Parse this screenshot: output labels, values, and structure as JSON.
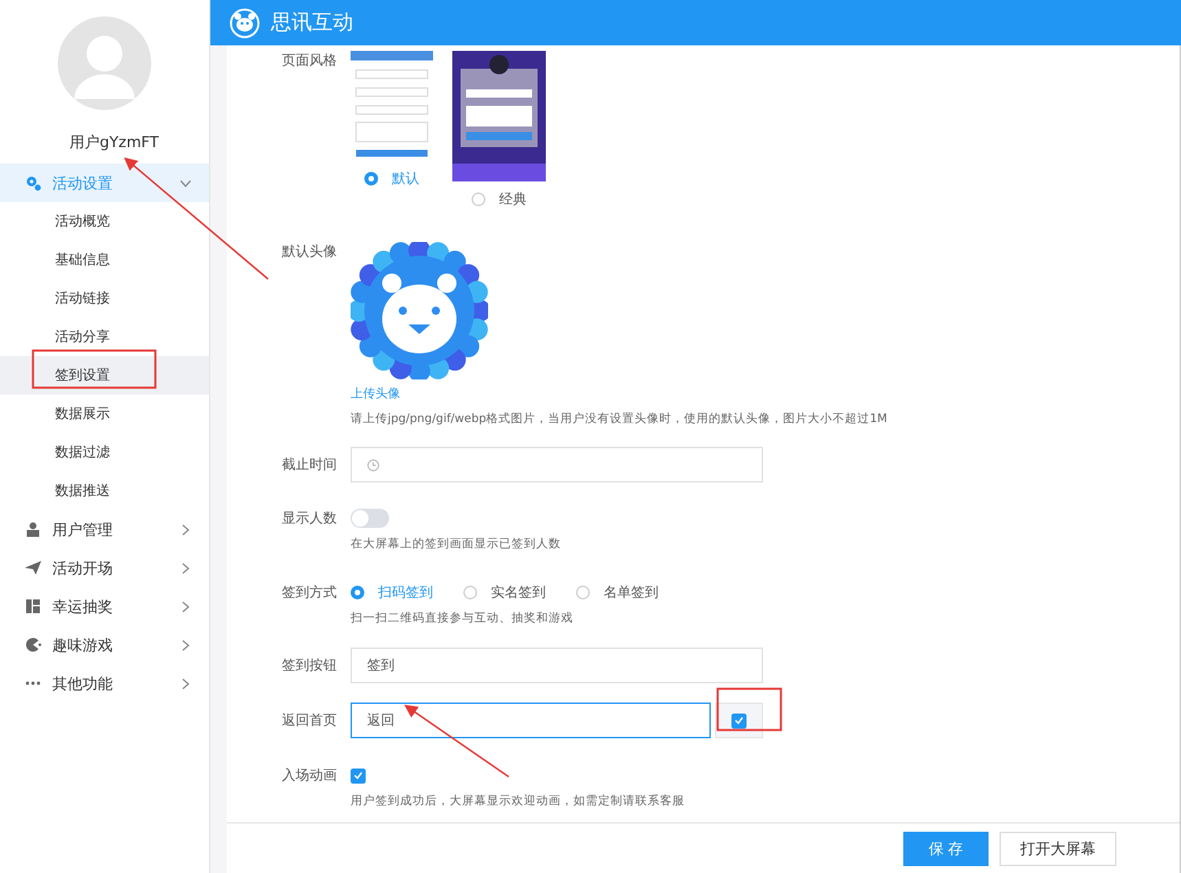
{
  "app": {
    "title": "思讯互动"
  },
  "user": {
    "name": "用户gYzmFT"
  },
  "menu": [
    {
      "label": "活动设置",
      "expanded": true,
      "children": [
        {
          "label": "活动概览",
          "selected": false
        },
        {
          "label": "基础信息",
          "selected": false
        },
        {
          "label": "活动链接",
          "selected": false
        },
        {
          "label": "活动分享",
          "selected": false
        },
        {
          "label": "签到设置",
          "selected": true
        },
        {
          "label": "数据展示",
          "selected": false
        },
        {
          "label": "数据过滤",
          "selected": false
        },
        {
          "label": "数据推送",
          "selected": false
        }
      ]
    },
    {
      "label": "用户管理",
      "expanded": false
    },
    {
      "label": "活动开场",
      "expanded": false
    },
    {
      "label": "幸运抽奖",
      "expanded": false
    },
    {
      "label": "趣味游戏",
      "expanded": false
    },
    {
      "label": "其他功能",
      "expanded": false
    }
  ],
  "page_style": {
    "label": "页面风格",
    "options": [
      {
        "label": "默认",
        "selected": true
      },
      {
        "label": "经典",
        "selected": false
      }
    ]
  },
  "default_avatar": {
    "label": "默认头像",
    "upload_link": "上传头像",
    "hint": "请上传jpg/png/gif/webp格式图片，当用户没有设置头像时，使用的默认头像，图片大小不超过1M"
  },
  "deadline": {
    "label": "截止时间"
  },
  "show_count": {
    "label": "显示人数",
    "on": false,
    "hint": "在大屏幕上的签到画面显示已签到人数"
  },
  "checkin_method": {
    "label": "签到方式",
    "options": [
      {
        "label": "扫码签到",
        "selected": true
      },
      {
        "label": "实名签到",
        "selected": false
      },
      {
        "label": "名单签到",
        "selected": false
      }
    ],
    "hint": "扫一扫二维码直接参与互动、抽奖和游戏"
  },
  "checkin_button": {
    "label": "签到按钮",
    "value": "签到"
  },
  "return_home": {
    "label": "返回首页",
    "value": "返回",
    "focused": true,
    "checked": true
  },
  "entrance_animation": {
    "label": "入场动画",
    "checked": true,
    "hint": "用户签到成功后，大屏幕显示欢迎动画，如需定制请联系客服"
  },
  "footer": {
    "buttons": [
      {
        "label": "保 存",
        "kind": "primary"
      },
      {
        "label": "打开大屏幕",
        "kind": "default"
      }
    ]
  }
}
